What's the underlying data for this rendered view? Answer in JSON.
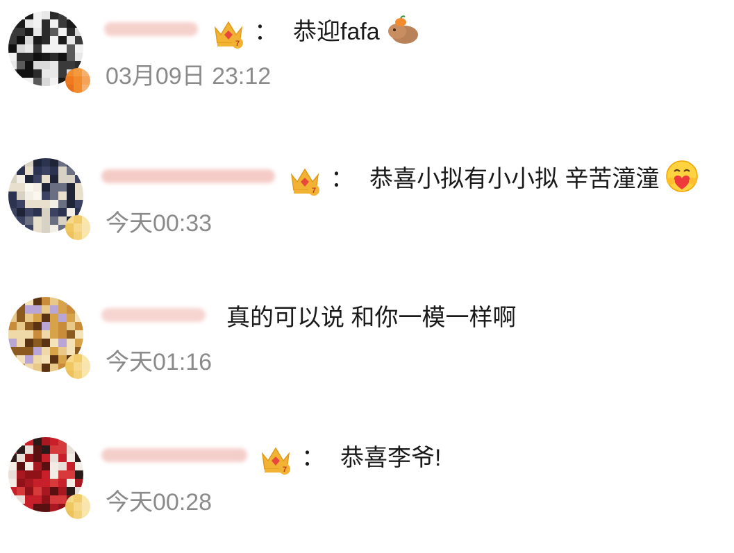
{
  "colors": {
    "text": "#1a1a1a",
    "time": "#8a8a8a",
    "name_blur": "#f3c6c2",
    "crown_gold": "#f2b233",
    "crown_gem": "#e8483c"
  },
  "comments": [
    {
      "has_crown": true,
      "text": "恭迎fafa",
      "emoji": "capybara-emoji",
      "time": "03月09日 23:12",
      "badge": "orange-badge"
    },
    {
      "has_crown": true,
      "text": "恭喜小拟有小小拟 辛苦潼潼",
      "emoji": "hug-heart-emoji",
      "time": "今天00:33",
      "badge": "gold-badge"
    },
    {
      "has_crown": false,
      "text": "真的可以说 和你一模一样啊",
      "time": "今天01:16",
      "badge": "gold-badge"
    },
    {
      "has_crown": true,
      "text": "恭喜李爷!",
      "time": "今天00:28",
      "badge": "gold-badge"
    }
  ],
  "colon": "："
}
